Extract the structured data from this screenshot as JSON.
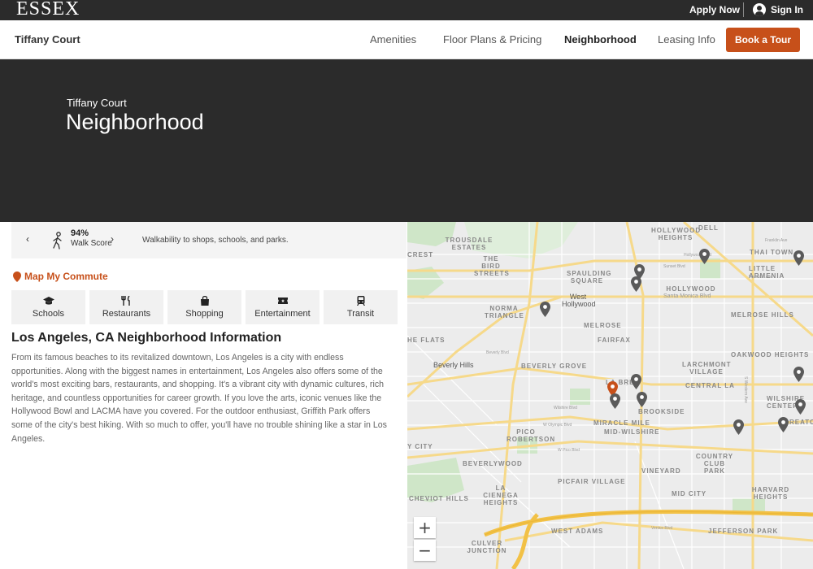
{
  "topbar": {
    "logo": "ESSEX",
    "apply_now": "Apply Now",
    "sign_in": "Sign In"
  },
  "nav": {
    "property": "Tiffany Court",
    "links": [
      "Amenities",
      "Floor Plans & Pricing",
      "Neighborhood",
      "Leasing Info"
    ],
    "active_link": "Neighborhood",
    "book_tour": "Book a Tour"
  },
  "hero": {
    "subtitle": "Tiffany Court",
    "title": "Neighborhood"
  },
  "walk_score": {
    "value": "94%",
    "label": "Walk Score",
    "description": "Walkability to shops, schools, and parks.",
    "prev_icon": "chevron-left-icon",
    "next_icon": "chevron-right-icon"
  },
  "commute": {
    "label": "Map My Commute"
  },
  "categories": [
    {
      "label": "Schools",
      "icon": "graduation-cap-icon"
    },
    {
      "label": "Restaurants",
      "icon": "utensils-icon"
    },
    {
      "label": "Shopping",
      "icon": "shopping-bag-icon"
    },
    {
      "label": "Entertainment",
      "icon": "ticket-icon"
    },
    {
      "label": "Transit",
      "icon": "train-icon"
    }
  ],
  "neighborhood": {
    "city": "Los Angeles, CA",
    "heading_rest": "Neighborhood Information",
    "body": "From its famous beaches to its revitalized downtown, Los Angeles is a city with endless opportunities. Along with the biggest names in entertainment, Los Angeles also offers some of the world's most exciting bars, restaurants, and shopping. It's a vibrant city with dynamic cultures, rich heritage, and countless opportunities for career growth. If you love the arts, iconic venues like the Hollywood Bowl and LACMA have you covered. For the outdoor enthusiast, Griffith Park offers some of the city's best hiking. With so much to offer, you'll have no trouble shining like a star in Los Angeles."
  },
  "map": {
    "labels": [
      "DELL",
      "HOLLYWOOD HEIGHTS",
      "TROUSDALE ESTATES",
      "THE BIRD STREETS",
      "THAI TOWN",
      "LITTLE ARMENIA",
      "SPAULDING SQUARE",
      "HOLLYWOOD",
      "CREST",
      "West Hollywood",
      "NORMA TRIANGLE",
      "MELROSE HILLS",
      "MELROSE",
      "FAIRFAX",
      "HE FLATS",
      "OAKWOOD HEIGHTS",
      "Beverly Hills",
      "BEVERLY GROVE",
      "LARCHMONT VILLAGE",
      "CENTRAL LA",
      "WILSHIRE CENTER",
      "BROOKSIDE",
      "KOREATOWN",
      "MIRACLE MILE",
      "MID-WILSHIRE",
      "PICO ROBERTSON",
      "Y CITY",
      "COUNTRY CLUB PARK",
      "BEVERLYWOOD",
      "VINEYARD",
      "PICFAIR VILLAGE",
      "LA CIENEGA HEIGHTS",
      "MID CITY",
      "HARVARD HEIGHTS",
      "CHEVIOT HILLS",
      "WEST ADAMS",
      "JEFFERSON PARK",
      "CULVER JUNCTION",
      "LA BREA"
    ],
    "streets": [
      "Santa Monica Blvd",
      "Sunset Blvd",
      "Hollywood Blvd",
      "Wilshire Blvd",
      "Beverly Blvd",
      "W Olympic Blvd",
      "W Pico Blvd",
      "S Western Ave",
      "Venice Blvd",
      "Fountain Ave",
      "Franklin Ave"
    ],
    "zoom_in": "+",
    "zoom_out": "−",
    "marker_color": "#5a5a5a",
    "selected_marker_color": "#c7501a"
  },
  "colors": {
    "accent": "#c7501a",
    "dark": "#2b2b2b"
  }
}
